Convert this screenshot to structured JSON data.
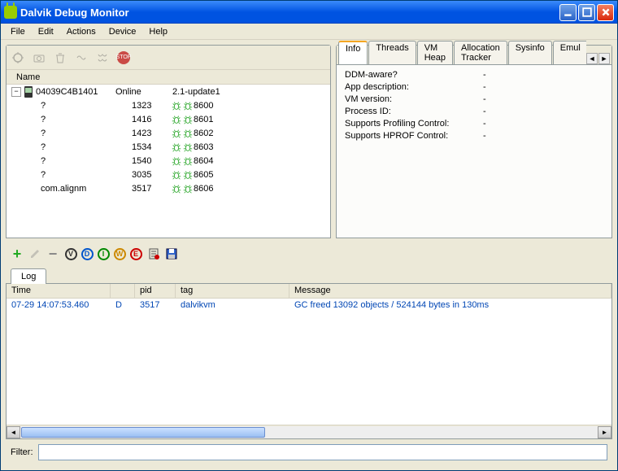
{
  "title": "Dalvik Debug Monitor",
  "menu": [
    "File",
    "Edit",
    "Actions",
    "Device",
    "Help"
  ],
  "devices_panel": {
    "name_col": "Name",
    "device": {
      "id": "04039C4B1401",
      "status": "Online",
      "build": "2.1-update1"
    },
    "processes": [
      {
        "name": "?",
        "pid": "1323",
        "port": "8600"
      },
      {
        "name": "?",
        "pid": "1416",
        "port": "8601"
      },
      {
        "name": "?",
        "pid": "1423",
        "port": "8602"
      },
      {
        "name": "?",
        "pid": "1534",
        "port": "8603"
      },
      {
        "name": "?",
        "pid": "1540",
        "port": "8604"
      },
      {
        "name": "?",
        "pid": "3035",
        "port": "8605"
      },
      {
        "name": "com.alignm",
        "pid": "3517",
        "port": "8606"
      }
    ]
  },
  "info_panel": {
    "tabs": [
      "Info",
      "Threads",
      "VM Heap",
      "Allocation Tracker",
      "Sysinfo",
      "Emul"
    ],
    "fields": [
      {
        "k": "DDM-aware?",
        "v": "-"
      },
      {
        "k": "App description:",
        "v": "-"
      },
      {
        "k": "VM version:",
        "v": "-"
      },
      {
        "k": "Process ID:",
        "v": "-"
      },
      {
        "k": "Supports Profiling Control:",
        "v": "-"
      },
      {
        "k": "Supports HPROF Control:",
        "v": "-"
      }
    ]
  },
  "log_panel": {
    "tab": "Log",
    "headers": {
      "time": "Time",
      "pid": "pid",
      "tag": "tag",
      "msg": "Message"
    },
    "rows": [
      {
        "time": "07-29 14:07:53.460",
        "lvl": "D",
        "pid": "3517",
        "tag": "dalvikvm",
        "msg": "GC freed 13092 objects / 524144 bytes in 130ms"
      }
    ]
  },
  "filter": {
    "label": "Filter:",
    "value": ""
  },
  "log_levels": [
    "V",
    "D",
    "I",
    "W",
    "E"
  ]
}
